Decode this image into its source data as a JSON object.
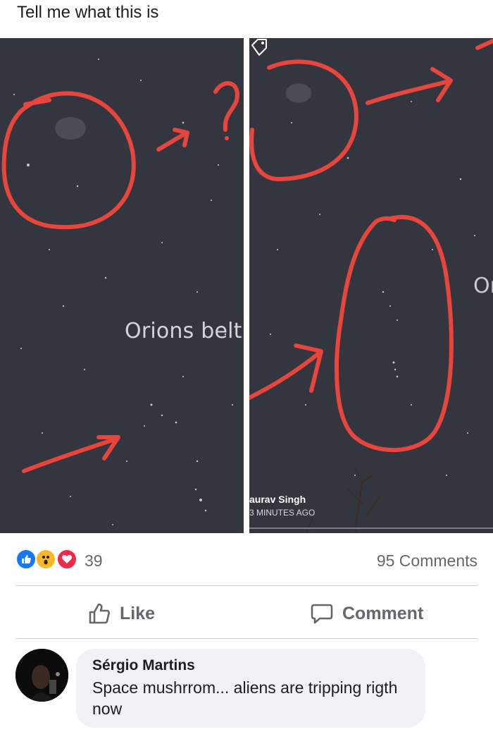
{
  "post": {
    "text": "Tell me what this is"
  },
  "photos": {
    "left_label": "Orions belt",
    "right_label_fragment": "Or",
    "story_name": "aurav Singh",
    "story_time": "3 MINUTES AGO"
  },
  "stats": {
    "reactions": [
      "like-icon",
      "wow-icon",
      "love-icon"
    ],
    "reaction_count": "39",
    "comments_count": "95 Comments"
  },
  "actions": {
    "like_label": "Like",
    "comment_label": "Comment"
  },
  "comment": {
    "author": "Sérgio Martins",
    "text": "Space mushrrom... aliens are tripping rigth now"
  },
  "colors": {
    "annotation_red": "#e8453c",
    "sky": "#33363f",
    "facebook_blue": "#1877f2",
    "secondary_text": "#65676b"
  }
}
